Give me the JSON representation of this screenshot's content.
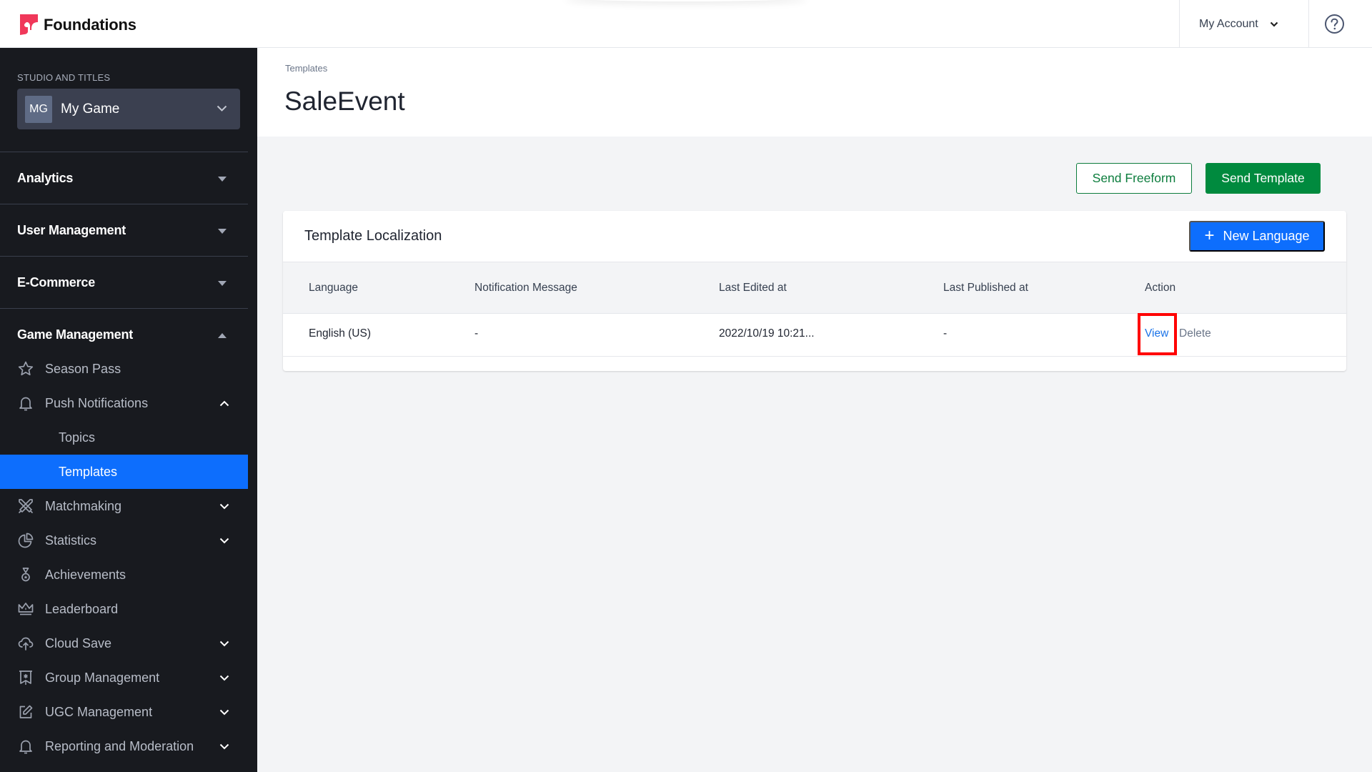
{
  "app": {
    "brand": "Foundations",
    "brand_color": "#f0385a"
  },
  "topbar": {
    "account_label": "My Account",
    "account_icon": "chevron-down-icon",
    "help_icon": "help-circle-icon"
  },
  "sidebar": {
    "studio_label": "STUDIO AND TITLES",
    "studio": {
      "initials": "MG",
      "name": "My Game"
    },
    "sections": [
      {
        "label": "Analytics",
        "expanded": false
      },
      {
        "label": "User Management",
        "expanded": false
      },
      {
        "label": "E-Commerce",
        "expanded": false
      },
      {
        "label": "Game Management",
        "expanded": true
      }
    ],
    "items": [
      {
        "label": "Season Pass",
        "icon": "star-icon",
        "has_children": false
      },
      {
        "label": "Push Notifications",
        "icon": "bell-icon",
        "has_children": true,
        "expanded": true,
        "children": [
          {
            "label": "Topics",
            "active": false
          },
          {
            "label": "Templates",
            "active": true
          }
        ]
      },
      {
        "label": "Matchmaking",
        "icon": "crossed-swords-icon",
        "has_children": true
      },
      {
        "label": "Statistics",
        "icon": "pie-chart-icon",
        "has_children": true
      },
      {
        "label": "Achievements",
        "icon": "medal-icon",
        "has_children": false
      },
      {
        "label": "Leaderboard",
        "icon": "crown-icon",
        "has_children": false
      },
      {
        "label": "Cloud Save",
        "icon": "cloud-upload-icon",
        "has_children": true
      },
      {
        "label": "Group Management",
        "icon": "banner-icon",
        "has_children": true
      },
      {
        "label": "UGC Management",
        "icon": "edit-icon",
        "has_children": true
      },
      {
        "label": "Reporting and Moderation",
        "icon": "bell-icon",
        "has_children": true
      }
    ],
    "active_color": "#0d6efd"
  },
  "page": {
    "breadcrumb": "Templates",
    "title": "SaleEvent",
    "actions": {
      "send_freeform": "Send Freeform",
      "send_template": "Send Template"
    }
  },
  "localization": {
    "title": "Template Localization",
    "new_language": "New Language",
    "columns": [
      "Language",
      "Notification Message",
      "Last Edited at",
      "Last Published at",
      "Action"
    ],
    "rows": [
      {
        "language": "English (US)",
        "message": "-",
        "last_edited": "2022/10/19 10:21...",
        "last_published": "-",
        "actions": {
          "view": "View",
          "delete": "Delete"
        }
      }
    ]
  },
  "annotation": {
    "highlight_target": "View",
    "color": "#ff0000"
  }
}
